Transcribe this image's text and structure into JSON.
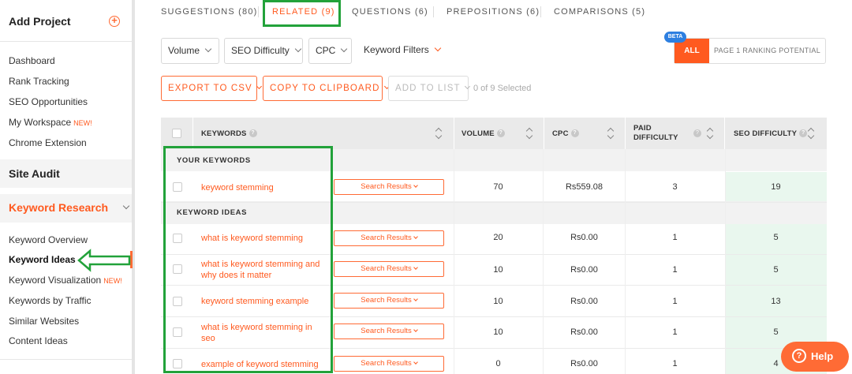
{
  "sidebar": {
    "add_project": "Add Project",
    "project_links": [
      "Dashboard",
      "Rank Tracking",
      "SEO Opportunities",
      "My Workspace",
      "Chrome Extension"
    ],
    "workspace_badge": "NEW!",
    "site_audit": "Site Audit",
    "keyword_research": "Keyword Research",
    "kr_links": [
      "Keyword Overview",
      "Keyword Ideas",
      "Keyword Visualization",
      "Keywords by Traffic",
      "Similar Websites",
      "Content Ideas"
    ],
    "visualization_badge": "NEW!"
  },
  "tabs": [
    {
      "label": "SUGGESTIONS (80)"
    },
    {
      "label": "RELATED (9)"
    },
    {
      "label": "QUESTIONS (6)"
    },
    {
      "label": "PREPOSITIONS (6)"
    },
    {
      "label": "COMPARISONS (5)"
    }
  ],
  "filters": {
    "volume": "Volume",
    "seo_difficulty": "SEO Difficulty",
    "cpc": "CPC",
    "keyword_filters": "Keyword Filters"
  },
  "toggle": {
    "beta": "BETA",
    "all": "ALL",
    "page1": "PAGE 1 RANKING POTENTIAL"
  },
  "actions": {
    "export": "EXPORT TO CSV",
    "copy": "COPY TO CLIPBOARD",
    "add_to_list": "ADD TO LIST",
    "selected": "0 of 9 Selected"
  },
  "table": {
    "headers": {
      "keywords": "KEYWORDS",
      "volume": "VOLUME",
      "cpc": "CPC",
      "paid_difficulty_1": "PAID",
      "paid_difficulty_2": "DIFFICULTY",
      "seo_difficulty": "SEO DIFFICULTY"
    },
    "groups": {
      "your": "YOUR KEYWORDS",
      "ideas": "KEYWORD IDEAS"
    },
    "search_results_label": "Search Results",
    "your_keywords": [
      {
        "keyword": "keyword stemming",
        "volume": "70",
        "cpc": "Rs559.08",
        "pd": "3",
        "sd": "19"
      }
    ],
    "keyword_ideas": [
      {
        "keyword": "what is keyword stemming",
        "volume": "20",
        "cpc": "Rs0.00",
        "pd": "1",
        "sd": "5"
      },
      {
        "keyword": "what is keyword stemming and why does it matter",
        "volume": "10",
        "cpc": "Rs0.00",
        "pd": "1",
        "sd": "5"
      },
      {
        "keyword": "keyword stemming example",
        "volume": "10",
        "cpc": "Rs0.00",
        "pd": "1",
        "sd": "13"
      },
      {
        "keyword": "what is keyword stemming in seo",
        "volume": "10",
        "cpc": "Rs0.00",
        "pd": "1",
        "sd": "5"
      },
      {
        "keyword": "example of keyword stemming",
        "volume": "0",
        "cpc": "Rs0.00",
        "pd": "1",
        "sd": "4"
      }
    ]
  },
  "help": "Help",
  "colors": {
    "accent": "#ff5a1f",
    "annotation": "#22a23a",
    "beta": "#2d7fe0",
    "seo_cell": "#e9f7ee"
  }
}
